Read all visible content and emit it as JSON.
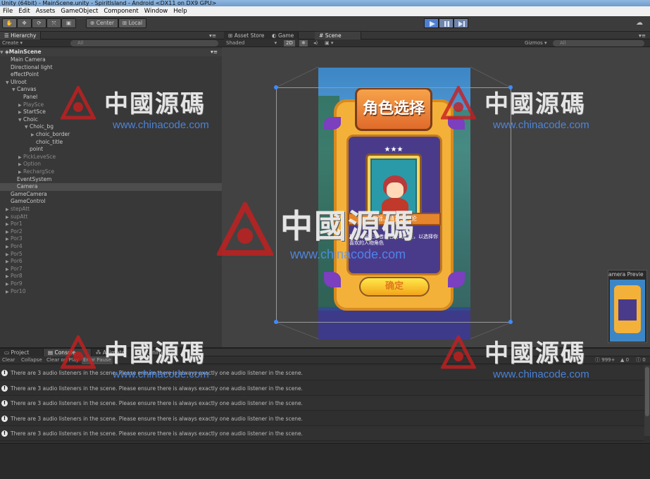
{
  "window": {
    "title": "Unity (64bit) - MainScene.unity - SpiritIsland - Android <DX11 on DX9 GPU>"
  },
  "menu": [
    "File",
    "Edit",
    "Assets",
    "GameObject",
    "Component",
    "Window",
    "Help"
  ],
  "toolbar": {
    "pivot": "Center",
    "space": "Local"
  },
  "hierarchy": {
    "tab": "Hierarchy",
    "create": "Create",
    "search_placeholder": "All",
    "scene_name": "MainScene",
    "rows": [
      {
        "label": "Main Camera",
        "indent": 0,
        "fold": "",
        "dim": false
      },
      {
        "label": "Directional light",
        "indent": 0,
        "fold": "",
        "dim": false
      },
      {
        "label": "effectPoint",
        "indent": 0,
        "fold": "",
        "dim": false
      },
      {
        "label": "UIroot",
        "indent": 0,
        "fold": "▼",
        "dim": false
      },
      {
        "label": "Canvas",
        "indent": 1,
        "fold": "▼",
        "dim": false
      },
      {
        "label": "Panel",
        "indent": 2,
        "fold": "",
        "dim": false
      },
      {
        "label": "PlaySce",
        "indent": 2,
        "fold": "▶",
        "dim": true
      },
      {
        "label": "StartSce",
        "indent": 2,
        "fold": "▶",
        "dim": false
      },
      {
        "label": "Choic",
        "indent": 2,
        "fold": "▼",
        "dim": false
      },
      {
        "label": "Choic_bg",
        "indent": 3,
        "fold": "▼",
        "dim": false
      },
      {
        "label": "choic_border",
        "indent": 4,
        "fold": "▶",
        "dim": false
      },
      {
        "label": "choic_title",
        "indent": 4,
        "fold": "",
        "dim": false
      },
      {
        "label": "point",
        "indent": 3,
        "fold": "",
        "dim": false
      },
      {
        "label": "PickLeveSce",
        "indent": 2,
        "fold": "▶",
        "dim": true
      },
      {
        "label": "Option",
        "indent": 2,
        "fold": "▶",
        "dim": true
      },
      {
        "label": "RechargSce",
        "indent": 2,
        "fold": "▶",
        "dim": true
      },
      {
        "label": "EventSystem",
        "indent": 1,
        "fold": "",
        "dim": false
      },
      {
        "label": "Camera",
        "indent": 1,
        "fold": "",
        "dim": false,
        "selected": true
      },
      {
        "label": "GameCamera",
        "indent": 0,
        "fold": "",
        "dim": false
      },
      {
        "label": "GameControl",
        "indent": 0,
        "fold": "",
        "dim": false
      },
      {
        "label": "stepAtt",
        "indent": 0,
        "fold": "▶",
        "dim": true
      },
      {
        "label": "supAtt",
        "indent": 0,
        "fold": "▶",
        "dim": true
      },
      {
        "label": "Por1",
        "indent": 0,
        "fold": "▶",
        "dim": true
      },
      {
        "label": "Por2",
        "indent": 0,
        "fold": "▶",
        "dim": true
      },
      {
        "label": "Por3",
        "indent": 0,
        "fold": "▶",
        "dim": true
      },
      {
        "label": "Por4",
        "indent": 0,
        "fold": "▶",
        "dim": true
      },
      {
        "label": "Por5",
        "indent": 0,
        "fold": "▶",
        "dim": true
      },
      {
        "label": "Por6",
        "indent": 0,
        "fold": "▶",
        "dim": true
      },
      {
        "label": "Por7",
        "indent": 0,
        "fold": "▶",
        "dim": true
      },
      {
        "label": "Por8",
        "indent": 0,
        "fold": "▶",
        "dim": true
      },
      {
        "label": "Por9",
        "indent": 0,
        "fold": "▶",
        "dim": true
      },
      {
        "label": "Por10",
        "indent": 0,
        "fold": "▶",
        "dim": true
      }
    ]
  },
  "scene": {
    "tabs": [
      "Asset Store",
      "Game",
      "Scene"
    ],
    "shading": "Shaded",
    "mode_2d": "2D",
    "gizmos": "Gizmos",
    "search_placeholder": "All",
    "camera_preview_label": "amera Previe"
  },
  "game_ui": {
    "title": "角色选择",
    "stars": "★★★",
    "name_banner": "天涯、精灵、何伦",
    "hint": "提示：向左或者向右滑动切换，以选择你喜欢的人物角色",
    "confirm": "确定"
  },
  "console": {
    "tabs": [
      "Project",
      "Console",
      "Animator",
      "Animation"
    ],
    "buttons": [
      "Clear",
      "Collapse",
      "Clear on Play",
      "Error Pause"
    ],
    "counts": {
      "log": "999+",
      "warn": "0",
      "error": "0"
    },
    "messages": [
      "There are 3 audio listeners in the scene. Please ensure there is always exactly one audio listener in the scene.",
      "There are 3 audio listeners in the scene. Please ensure there is always exactly one audio listener in the scene.",
      "There are 3 audio listeners in the scene. Please ensure there is always exactly one audio listener in the scene.",
      "There are 3 audio listeners in the scene. Please ensure there is always exactly one audio listener in the scene.",
      "There are 3 audio listeners in the scene. Please ensure there is always exactly one audio listener in the scene."
    ]
  },
  "watermark": {
    "text": "中國源碼",
    "url": "www.chinacode.com"
  }
}
